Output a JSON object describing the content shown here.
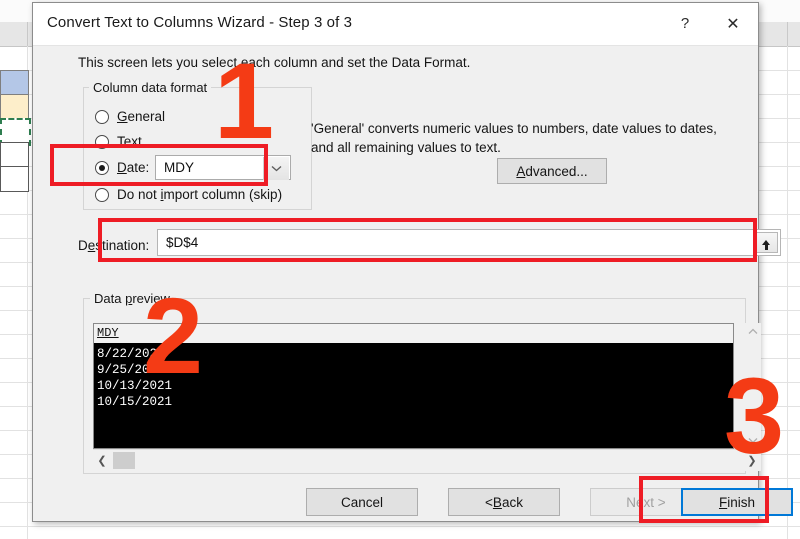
{
  "window": {
    "title": "Convert Text to Columns Wizard - Step 3 of 3",
    "help_label": "?",
    "close_label": "✕",
    "subtitle": "This screen lets you select each column and set the Data Format."
  },
  "column_data_format": {
    "legend": "Column data format",
    "options": [
      {
        "label": "General",
        "accel": "G",
        "rest": "eneral",
        "selected": false
      },
      {
        "label": "Text",
        "accel": "T",
        "rest": "ext",
        "selected": false
      },
      {
        "label": "Date:",
        "accel": "D",
        "rest": "ate:",
        "selected": true
      },
      {
        "label": "Do not import column (skip)",
        "pre": "Do not ",
        "accel": "i",
        "rest": "mport column (skip)",
        "selected": false
      }
    ],
    "date_format_value": "MDY",
    "dropdown_arrow": "chevron-down-icon"
  },
  "description": {
    "text": "'General' converts numeric values to numbers, date values to dates, and all remaining values to text.",
    "advanced_button": {
      "pre": "",
      "accel": "A",
      "rest": "dvanced..."
    }
  },
  "destination": {
    "label_pre": "D",
    "label_accel": "e",
    "label_rest": "stination:",
    "value": "$D$4",
    "picker_icon": "range-selector-up-arrow-icon"
  },
  "data_preview": {
    "legend_pre": "Data ",
    "legend_accel": "p",
    "legend_rest": "review",
    "column_header": "MDY",
    "rows": [
      "8/22/2021",
      "9/25/2021",
      "10/13/2021",
      "10/15/2021"
    ],
    "vscroll": {
      "up": "▲",
      "down": "▼"
    },
    "hscroll": {
      "left": "❮",
      "right": "❯"
    }
  },
  "footer": {
    "cancel": "Cancel",
    "back": {
      "pre": "< ",
      "accel": "B",
      "rest": "ack"
    },
    "next": "Next >",
    "finish": {
      "pre": "",
      "accel": "F",
      "rest": "inish"
    }
  },
  "annotations": {
    "one": "1",
    "two": "2",
    "three": "3",
    "color": "#f43b15",
    "box_color": "#ee1c25"
  }
}
